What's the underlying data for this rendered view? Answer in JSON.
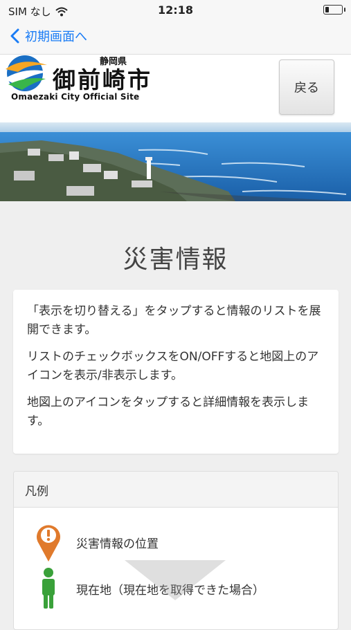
{
  "status_bar": {
    "carrier": "SIM なし",
    "time": "12:18"
  },
  "nav": {
    "back_label": "初期画面へ"
  },
  "header": {
    "logo_prefecture": "静岡県",
    "logo_city": "御前崎市",
    "logo_subtitle": "Omaezaki City Official Site",
    "back_button": "戻る"
  },
  "page": {
    "title": "災害情報"
  },
  "info": {
    "paragraphs": [
      "「表示を切り替える」をタップすると情報のリストを展開できます。",
      "リストのチェックボックスをON/OFFすると地図上のアイコンを表示/非表示します。",
      "地図上のアイコンをタップすると詳細情報を表示します。"
    ]
  },
  "legend": {
    "heading": "凡例",
    "items": [
      {
        "icon": "orange-exclamation-pin-icon",
        "label": "災害情報の位置"
      },
      {
        "icon": "green-person-icon",
        "label": "現在地（現在地を取得できた場合）"
      }
    ]
  },
  "colors": {
    "accent": "#1a7cf5",
    "pin": "#e07a2c",
    "person": "#3aa13a"
  }
}
